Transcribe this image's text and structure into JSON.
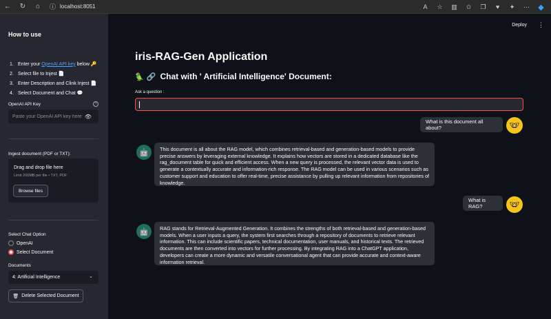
{
  "browser": {
    "url": "localhost:8051",
    "icons": [
      "back-icon",
      "reload-icon",
      "home-icon",
      "info-icon",
      "read-aloud-icon",
      "favorite-icon",
      "split-screen-icon",
      "favorites-icon",
      "collections-icon",
      "health-icon",
      "extensions-icon",
      "more-icon",
      "edge-copilot-icon"
    ]
  },
  "sidebar": {
    "title": "How to use",
    "steps": [
      {
        "num": "1.",
        "pre": "Enter your ",
        "link": "OpenAI API key",
        "post": " below 🔑"
      },
      {
        "num": "2.",
        "text": "Select file to Injest 📄"
      },
      {
        "num": "3.",
        "text": "Enter Description and Clink Injest 📄"
      },
      {
        "num": "4.",
        "text": "Select Document and Chat 💬"
      }
    ],
    "api_key_label": "OpenAI API Key",
    "api_key_placeholder": "Paste your OpenAI API key here",
    "ingest_label": "Ingest document (PDF or TXT):",
    "dropzone_title": "Drag and drop file here",
    "dropzone_limit": "Limit 200MB per file • TXT, PDF",
    "browse_label": "Browse files",
    "chat_option_label": "Select Chat Option",
    "chat_options": [
      "OpenAI",
      "Select Document"
    ],
    "chat_option_selected": "Select Document",
    "documents_label": "Documents",
    "documents_selected": "4: Artificial Intelligence",
    "delete_label": "Delete Selected Document"
  },
  "topbar": {
    "deploy_label": "Deploy",
    "menu_glyph": "⋮"
  },
  "main": {
    "title": "iris-RAG-Gen Application",
    "subtitle_icons": "🦜 🔗",
    "subtitle": "Chat with ' Artificial Intelligence' Document:",
    "ask_label": "Ask a question :",
    "question_value": ""
  },
  "chat": [
    {
      "role": "user",
      "text": "What is this document all about?"
    },
    {
      "role": "assistant",
      "text": "This document is all about the RAG model, which combines retrieval-based and generation-based models to provide precise answers by leveraging external knowledge. It explains how vectors are stored in a dedicated database like the rag_document table for quick and efficient access. When a new query is processed, the relevant vector data is used to generate a contextually accurate and information-rich response. The RAG model can be used in various scenarios such as customer support and education to offer real-time, precise assistance by pulling up relevant information from repositories of knowledge."
    },
    {
      "role": "user",
      "text": "What is RAG?"
    },
    {
      "role": "assistant",
      "text": "RAG stands for Retrieval-Augmented Generation. It combines the strengths of both retrieval-based and generation-based models. When a user inputs a query, the system first searches through a repository of documents to retrieve relevant information. This can include scientific papers, technical documentation, user manuals, and historical texts. The retrieved documents are then converted into vectors for further processing. By integrating RAG into a ChatGPT application, developers can create a more dynamic and versatile conversational agent that can provide accurate and context-aware information retrieval."
    }
  ],
  "avatars": {
    "user_glyph": "🤓",
    "bot_glyph": "🤖"
  },
  "colors": {
    "accent": "#ff4b4b",
    "link": "#4ea4ff",
    "sidebar_bg": "#262730",
    "main_bg": "#0e1117",
    "bubble_bg": "#2e3038"
  }
}
